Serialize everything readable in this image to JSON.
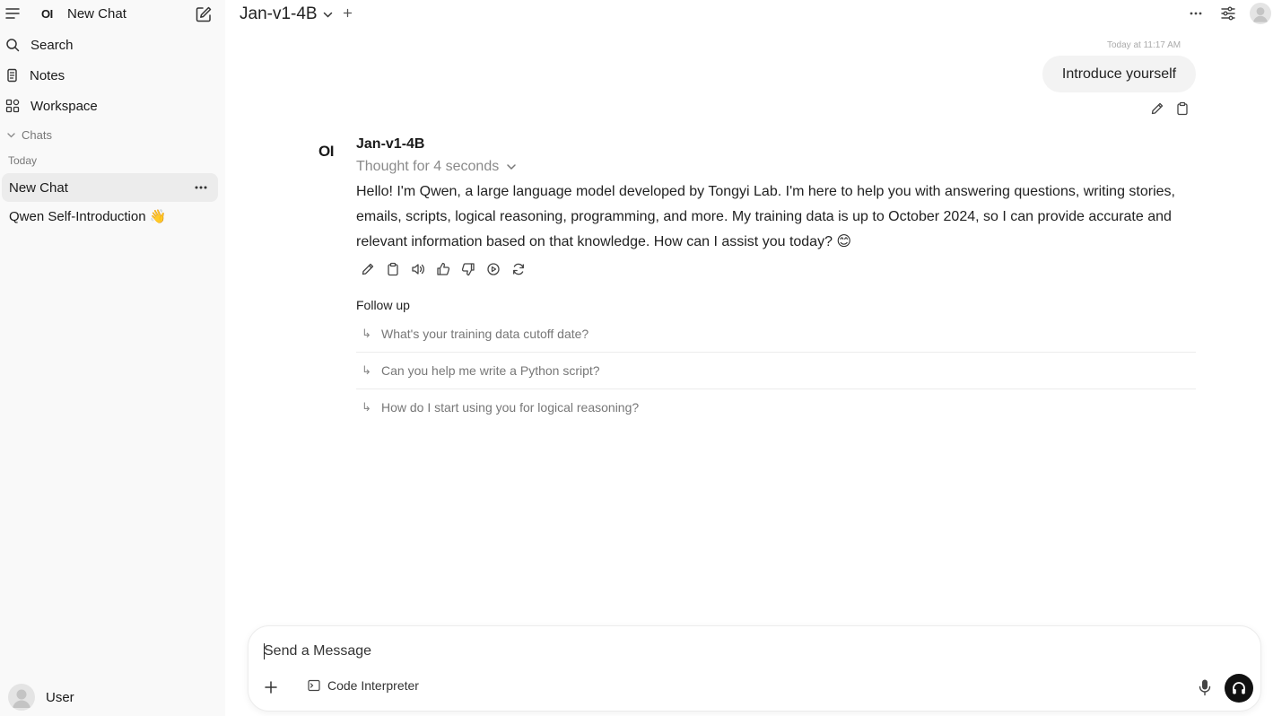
{
  "sidebar": {
    "logo": "OI",
    "title": "New Chat",
    "nav": [
      {
        "label": "Search",
        "icon": "search-icon"
      },
      {
        "label": "Notes",
        "icon": "notes-icon"
      },
      {
        "label": "Workspace",
        "icon": "workspace-icon"
      }
    ],
    "section_label": "Chats",
    "group_label": "Today",
    "chats": [
      {
        "label": "New Chat",
        "active": true
      },
      {
        "label": "Qwen Self-Introduction 👋",
        "active": false
      }
    ],
    "user_name": "User"
  },
  "header": {
    "model": "Jan-v1-4B"
  },
  "conversation": {
    "user_message": {
      "time": "Today at 11:17 AM",
      "text": "Introduce yourself"
    },
    "assistant": {
      "logo": "OI",
      "name": "Jan-v1-4B",
      "thought": "Thought for 4 seconds",
      "text": "Hello! I'm Qwen, a large language model developed by Tongyi Lab. I'm here to help you with answering questions, writing stories, emails, scripts, logical reasoning, programming, and more. My training data is up to October 2024, so I can provide accurate and relevant information based on that knowledge. How can I assist you today? 😊"
    },
    "followup": {
      "title": "Follow up",
      "items": [
        "What's your training data cutoff date?",
        "Can you help me write a Python script?",
        "How do I start using you for logical reasoning?"
      ]
    }
  },
  "composer": {
    "placeholder": "Send a Message",
    "tool_label": "Code Interpreter"
  },
  "colors": {
    "sidebar_bg": "#f9f9f9",
    "active_chat_bg": "#ececec",
    "user_bubble_bg": "#f3f3f3",
    "muted_text": "#8a8a8a",
    "voice_button": "#111111"
  }
}
